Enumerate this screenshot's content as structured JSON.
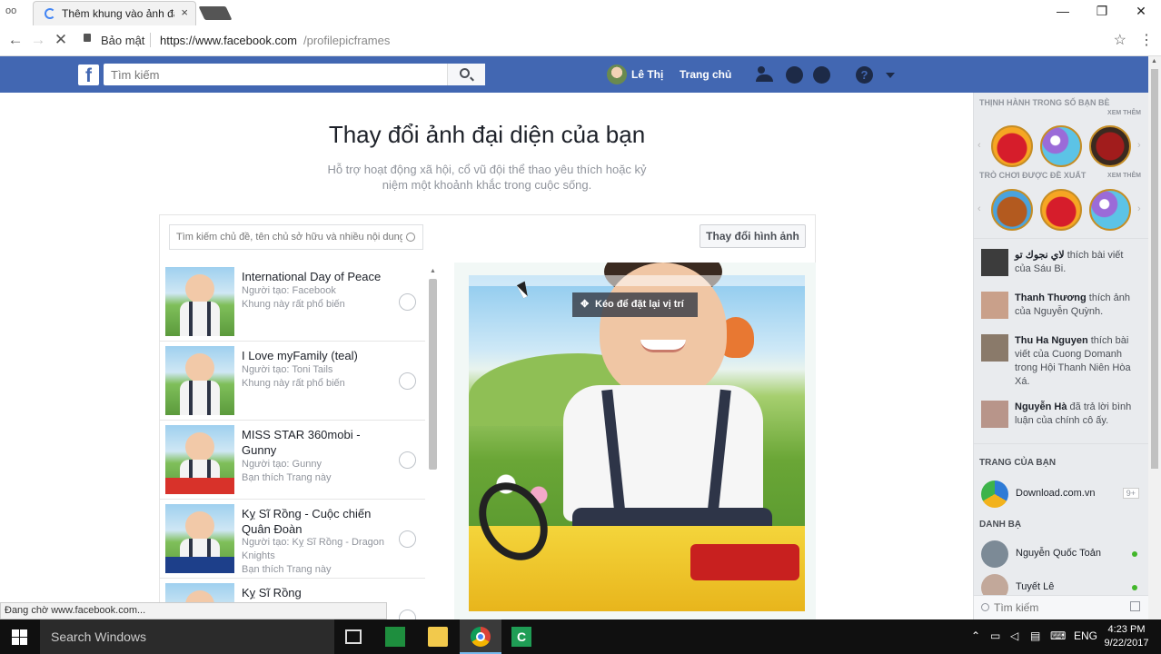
{
  "browser": {
    "tab_title": "Thêm khung vào ảnh đại",
    "tab_close": "×",
    "secure_label": "Bảo mật",
    "url_host": "https://www.facebook.com",
    "url_path": "/profilepicframes",
    "window_controls": {
      "minimize": "—",
      "maximize": "❐",
      "close": "✕"
    }
  },
  "fb_header": {
    "logo": "f",
    "search_placeholder": "Tìm kiếm",
    "user_name": "Lê Thị",
    "home": "Trang chủ",
    "help": "?"
  },
  "main": {
    "title": "Thay đổi ảnh đại diện của bạn",
    "subtitle": "Hỗ trợ hoạt động xã hội, cổ vũ đội thể thao yêu thích hoặc kỷ niệm một khoảnh khắc trong cuộc sống.",
    "frame_search_placeholder": "Tìm kiếm chủ đề, tên chủ sở hữu và nhiều nội dung",
    "change_image_button": "Thay đổi hình ảnh",
    "drag_tip": "Kéo để đặt lại vị trí",
    "frames": [
      {
        "name": "International Day of Peace",
        "creator": "Người tạo: Facebook",
        "info": "Khung này rất phổ biến"
      },
      {
        "name": "I Love myFamily (teal)",
        "creator": "Người tạo: Toni Tails",
        "info": "Khung này rất phổ biến"
      },
      {
        "name": "MISS STAR 360mobi - Gunny",
        "creator": "Người tạo: Gunny",
        "info": "Bạn thích Trang này"
      },
      {
        "name": "Kỵ Sĩ Rồng - Cuộc chiến Quân Đoàn",
        "creator": "Người tạo: Kỵ Sĩ Rồng - Dragon Knights",
        "info": "Bạn thích Trang này"
      },
      {
        "name": "Kỵ Sĩ Rồng",
        "creator": "",
        "info": ""
      }
    ]
  },
  "sidebar": {
    "trending_heading": "THỊNH HÀNH TRONG SỐ BẠN BÈ",
    "see_more_1": "XEM THÊM",
    "suggested_heading": "TRÒ CHƠI ĐƯỢC ĐỀ XUẤT",
    "see_more_2": "XEM THÊM",
    "activities": [
      {
        "actor": "لاي نجوك تو",
        "text": " thích bài viết của Sáu Bi."
      },
      {
        "actor": "Thanh Thương",
        "text": " thích ảnh của Nguyễn Quỳnh."
      },
      {
        "actor": "Thu Ha Nguyen",
        "text": " thích bài viết của Cuong Domanh trong Hội Thanh Niên Hòa Xá."
      },
      {
        "actor": "Nguyễn Hà",
        "text": " đã trả lời bình luận của chính cô ấy."
      }
    ],
    "pages_heading": "TRANG CỦA BẠN",
    "page_name": "Download.com.vn",
    "page_count": "9+",
    "contacts_heading": "DANH BẠ",
    "contacts": [
      "Nguyễn Quốc Toản",
      "Tuyết Lê"
    ],
    "chat_search_placeholder": "Tìm kiếm"
  },
  "status_text": "Đang chờ www.facebook.com...",
  "taskbar": {
    "search_placeholder": "Search Windows",
    "language": "ENG",
    "time": "4:23 PM",
    "date": "9/22/2017",
    "camtasia_letter": "C"
  },
  "colors": {
    "fb_blue": "#4267b2",
    "sidebar_bg": "#e9ebee",
    "taskbar": "#101010"
  }
}
